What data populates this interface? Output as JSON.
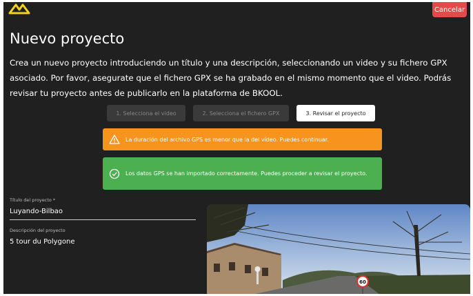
{
  "header": {
    "logo_icon": "bkool-logo-icon",
    "cancel_label": "Cancelar"
  },
  "page": {
    "title": "Nuevo proyecto",
    "intro": "Crea un nuevo proyecto introduciendo un título y una descripción, seleccionando un video y su fichero GPX asociado. Por favor, asegurate que el fichero GPX se ha grabado en el mismo momento que el video. Podrás revisar tu proyecto antes de publicarlo en la plataforma de BKOOL."
  },
  "steps": [
    {
      "label": "1. Selecciona el video",
      "state": "disabled"
    },
    {
      "label": "2. Selecciona el fichero GPX",
      "state": "disabled"
    },
    {
      "label": "3. Revisar el proyecto",
      "state": "active"
    }
  ],
  "alerts": {
    "warning": {
      "icon": "warning-triangle-icon",
      "text": "La duración del archivo GPS es menor que la del vídeo. Puedes continuar."
    },
    "success": {
      "icon": "check-circle-icon",
      "text": "Los datos GPS se han importado correctamente. Puedes proceder a revisar el proyecto."
    }
  },
  "form": {
    "title_label": "Título del proyecto *",
    "title_value": "Luyando-Bilbao",
    "description_label": "Descripción del proyecto",
    "description_value": "5 tour du Polygone"
  },
  "preview": {
    "icon": "video-thumbnail",
    "sign_text": "60"
  },
  "colors": {
    "background": "#202020",
    "cancel": "#e34b4b",
    "warning": "#f7941d",
    "success": "#4caf50",
    "logo": "#f2d21c"
  }
}
